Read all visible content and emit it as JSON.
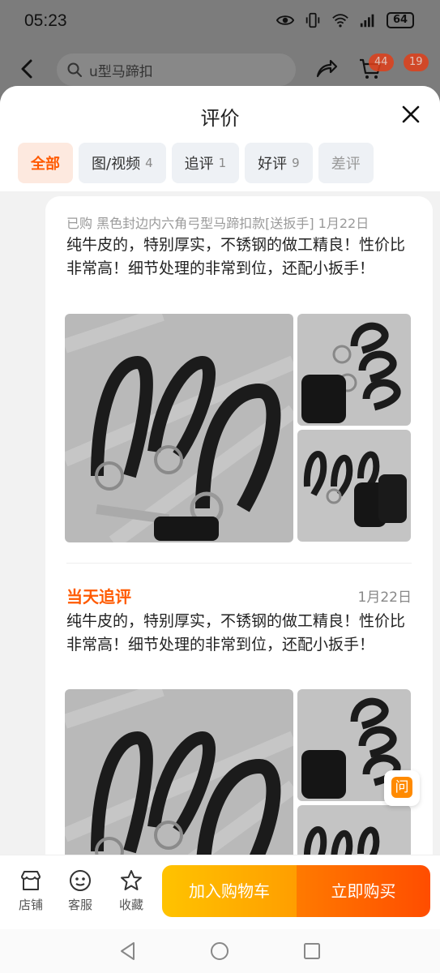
{
  "status_bar": {
    "time": "05:23",
    "battery": "64"
  },
  "header": {
    "search_placeholder": "u型马蹄扣",
    "cart_badge": "44",
    "message_badge": "19"
  },
  "sheet": {
    "title": "评价",
    "tabs": [
      {
        "label": "全部",
        "count": ""
      },
      {
        "label": "图/视频",
        "count": "4"
      },
      {
        "label": "追评",
        "count": "1"
      },
      {
        "label": "好评",
        "count": "9"
      },
      {
        "label": "差评",
        "count": ""
      }
    ]
  },
  "review": {
    "meta": "已购 黑色封边内六角弓型马蹄扣款[送扳手] 1月22日",
    "text": "纯牛皮的，特别厚实，不锈钢的做工精良！性价比非常高！细节处理的非常到位，还配小扳手！",
    "append_label": "当天追评",
    "append_date": "1月22日",
    "append_text": "纯牛皮的，特别厚实，不锈钢的做工精良！性价比非常高！细节处理的非常到位，还配小扳手！"
  },
  "ask_button": {
    "label": "问"
  },
  "bottom_bar": {
    "store": "店铺",
    "service": "客服",
    "favorite": "收藏",
    "add_to_cart": "加入购物车",
    "buy_now": "立即购买"
  },
  "colors": {
    "accent": "#ff5a00",
    "cart_button": "#ffb400",
    "buy_button": "#ff5a00"
  }
}
